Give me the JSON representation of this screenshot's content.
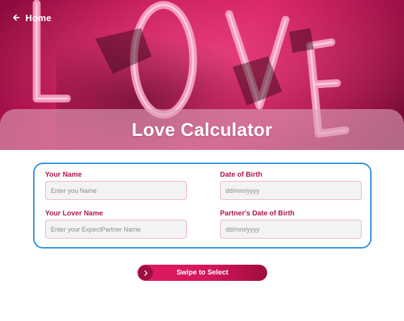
{
  "nav": {
    "home_label": "Home"
  },
  "hero": {
    "title": "Love Calculator",
    "background_text": "LOVE"
  },
  "form": {
    "your_name": {
      "label": "Your Name",
      "placeholder": "Enter you Name"
    },
    "date_of_birth": {
      "label": "Date of Birth",
      "placeholder": "dd/mm/yyyy"
    },
    "lover_name": {
      "label": "Your Lover Name",
      "placeholder": "Enter your ExpectPartner Name"
    },
    "partner_dob": {
      "label": "Partner's Date of Birth",
      "placeholder": "dd/mm/yyyy"
    }
  },
  "swipe": {
    "label": "Swipe to Select"
  },
  "colors": {
    "accent": "#b0134e",
    "card_border": "#2f8fe0",
    "button_start": "#e01a63",
    "button_end": "#9e0d3d"
  },
  "icons": {
    "home": "arrow-left-icon",
    "swipe": "chevron-right-icon"
  }
}
